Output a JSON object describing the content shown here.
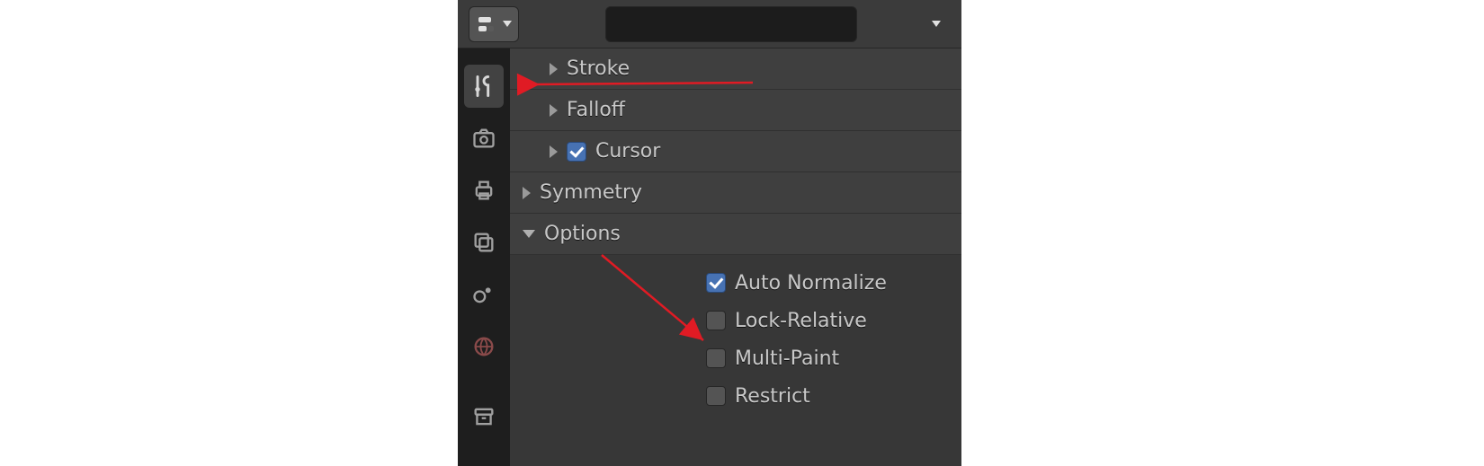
{
  "header": {
    "search_placeholder": ""
  },
  "tabs": [
    {
      "id": "tool",
      "icon": "tool-icon",
      "active": true
    },
    {
      "id": "render",
      "icon": "camera-icon",
      "active": false
    },
    {
      "id": "output",
      "icon": "printer-icon",
      "active": false
    },
    {
      "id": "viewlayer",
      "icon": "layers-icon",
      "active": false
    },
    {
      "id": "scene",
      "icon": "scene-icon",
      "active": false
    },
    {
      "id": "world",
      "icon": "world-icon",
      "active": false
    },
    {
      "id": "object",
      "icon": "archive-icon",
      "active": false
    }
  ],
  "panels": {
    "stroke": {
      "label": "Stroke",
      "expanded": false
    },
    "falloff": {
      "label": "Falloff",
      "expanded": false
    },
    "cursor": {
      "label": "Cursor",
      "expanded": false,
      "checked": true
    },
    "symmetry": {
      "label": "Symmetry",
      "expanded": false
    },
    "options": {
      "label": "Options",
      "expanded": true,
      "items": [
        {
          "label": "Auto Normalize",
          "checked": true
        },
        {
          "label": "Lock-Relative",
          "checked": false
        },
        {
          "label": "Multi-Paint",
          "checked": false
        },
        {
          "label": "Restrict",
          "checked": false
        }
      ]
    }
  },
  "colors": {
    "accent": "#4772b3",
    "annotation": "#e01b24"
  }
}
